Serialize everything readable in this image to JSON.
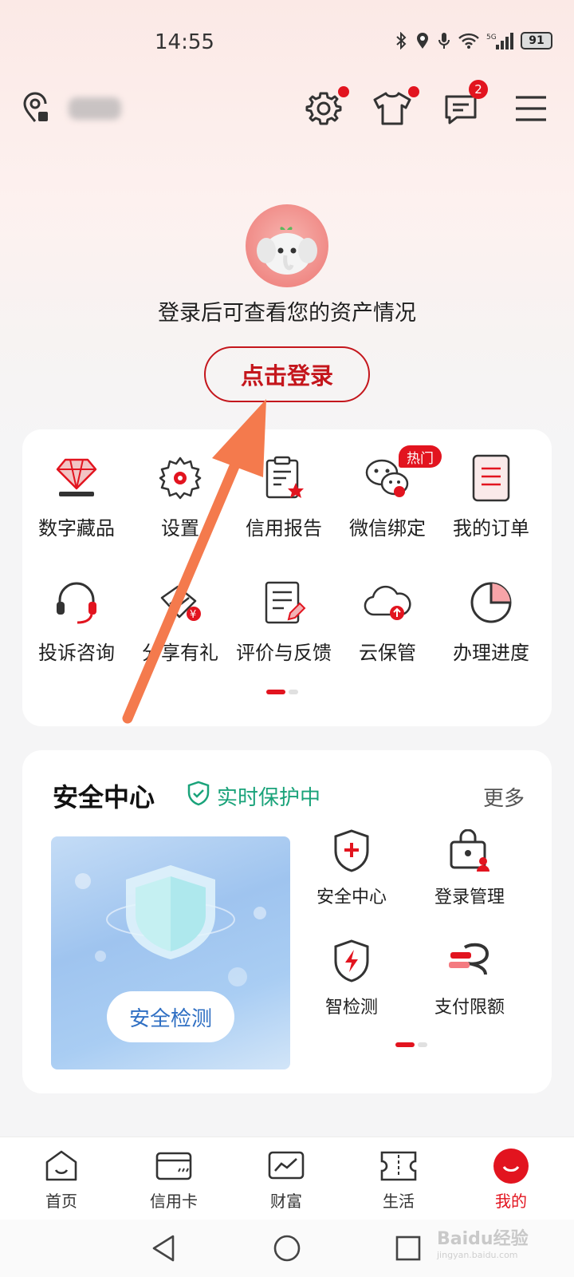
{
  "status_bar": {
    "time": "14:55",
    "battery": "91",
    "network": "5G"
  },
  "header": {
    "icons": [
      "location-icon",
      "settings-icon",
      "tshirt-icon",
      "message-icon",
      "menu-icon"
    ],
    "message_badge": "2"
  },
  "login": {
    "tip": "登录后可查看您的资产情况",
    "button": "点击登录"
  },
  "grid": {
    "hot_tag": "热门",
    "items": [
      {
        "label": "数字藏品",
        "icon": "diamond-icon"
      },
      {
        "label": "设置",
        "icon": "gear-icon"
      },
      {
        "label": "信用报告",
        "icon": "credit-report-icon"
      },
      {
        "label": "微信绑定",
        "icon": "wechat-icon"
      },
      {
        "label": "我的订单",
        "icon": "order-icon"
      },
      {
        "label": "投诉咨询",
        "icon": "headset-icon"
      },
      {
        "label": "分享有礼",
        "icon": "share-gift-icon"
      },
      {
        "label": "评价与反馈",
        "icon": "feedback-icon"
      },
      {
        "label": "云保管",
        "icon": "cloud-icon"
      },
      {
        "label": "办理进度",
        "icon": "progress-pie-icon"
      }
    ]
  },
  "security": {
    "title": "安全中心",
    "status": "实时保护中",
    "more": "更多",
    "banner_button": "安全检测",
    "items": [
      {
        "label": "安全中心",
        "icon": "shield-plus-icon"
      },
      {
        "label": "登录管理",
        "icon": "login-manage-icon"
      },
      {
        "label": "智检测",
        "icon": "shield-bolt-icon"
      },
      {
        "label": "支付限额",
        "icon": "pay-limit-icon"
      }
    ]
  },
  "tabbar": {
    "items": [
      {
        "label": "首页",
        "icon": "home-icon"
      },
      {
        "label": "信用卡",
        "icon": "credit-card-icon"
      },
      {
        "label": "财富",
        "icon": "wealth-chart-icon"
      },
      {
        "label": "生活",
        "icon": "ticket-icon"
      },
      {
        "label": "我的",
        "icon": "profile-smile-icon",
        "active": true
      }
    ]
  },
  "watermark": {
    "text": "Baidu经验",
    "sub": "jingyan.baidu.com"
  },
  "colors": {
    "accent": "#e2141f",
    "safe_green": "#1aa37a",
    "annotation_arrow": "#f47a4d"
  }
}
